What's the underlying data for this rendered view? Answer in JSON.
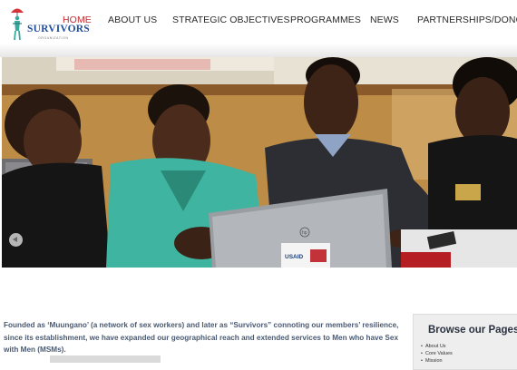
{
  "logo": {
    "title": "SURVIVORS",
    "subtitle": "ORGANIZATION"
  },
  "nav": {
    "items": [
      {
        "label": "HOME",
        "active": true
      },
      {
        "label": "ABOUT US",
        "active": false
      },
      {
        "label": "STRATEGIC OBJECTIVES",
        "active": false
      },
      {
        "label": "PROGRAMMES",
        "active": false
      },
      {
        "label": "NEWS",
        "active": false
      },
      {
        "label": "PARTNERSHIPS/DONORS",
        "active": false
      }
    ]
  },
  "hero": {
    "laptop_sticker": "USAID",
    "laptop_brand": "hp"
  },
  "intro": {
    "text": "Founded as ‘Muungano’ (a network of sex workers) and later as “Survivors” connoting our members’ resilience, since its establishment, we have expanded our geographical reach and extended services to Men who have Sex with Men (MSMs)."
  },
  "sidebar": {
    "title": "Browse our Pages",
    "links": [
      "About Us",
      "Core Values",
      "Mission"
    ]
  },
  "colors": {
    "accent": "#c8282d",
    "nav_text": "#2a2a2a",
    "intro_text": "#4a5a72",
    "logo_blue": "#1f4e9c",
    "logo_teal": "#3aa99f"
  }
}
